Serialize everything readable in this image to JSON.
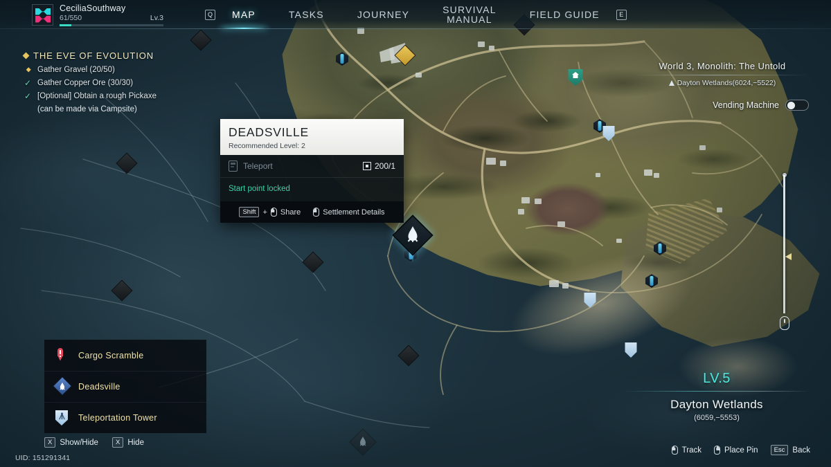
{
  "header": {
    "player_name": "CeciliaSouthway",
    "xp": "61/550",
    "level": "Lv.3",
    "xp_percent": 11,
    "nav_left_key": "Q",
    "nav_right_key": "E",
    "tabs": [
      {
        "label": "MAP",
        "active": true
      },
      {
        "label": "TASKS",
        "active": false
      },
      {
        "label": "JOURNEY",
        "active": false
      },
      {
        "label": "SURVIVAL",
        "label2": "MANUAL",
        "active": false
      },
      {
        "label": "FIELD GUIDE",
        "active": false
      }
    ]
  },
  "quest": {
    "title": "THE EVE OF EVOLUTION",
    "objectives": [
      {
        "text": "Gather Gravel  (20/50)",
        "state": "active"
      },
      {
        "text": "Gather Copper Ore  (30/30)",
        "state": "done"
      },
      {
        "text": "[Optional] Obtain a rough Pickaxe",
        "sub": "(can be made via Campsite)",
        "state": "done"
      }
    ]
  },
  "popup": {
    "name": "DEADSVILLE",
    "recommended_level": "Recommended Level: 2",
    "teleport_label": "Teleport",
    "teleport_cost": "200/1",
    "status": "Start point locked",
    "shift_key": "Shift",
    "plus": "+",
    "share_label": "Share",
    "details_label": "Settlement Details"
  },
  "world": {
    "title": "World 3, Monolith: The Untold",
    "coordinates": "Dayton Wetlands(6024,−5522)",
    "vending_label": "Vending Machine",
    "vending_on": false
  },
  "legend": {
    "items": [
      {
        "label": "Cargo Scramble",
        "icon": "cargo-pin-icon"
      },
      {
        "label": "Deadsville",
        "icon": "settlement-diamond-icon"
      },
      {
        "label": "Teleportation Tower",
        "icon": "teleport-tower-shield-icon"
      }
    ]
  },
  "location": {
    "level": "LV.5",
    "name": "Dayton Wetlands",
    "coordinates": "(6059,−5553)"
  },
  "bottom_left": {
    "items": [
      {
        "key": "X",
        "label": "Show/Hide"
      },
      {
        "key": "X",
        "label": "Hide"
      }
    ],
    "uid": "UID: 151291341"
  },
  "bottom_right": {
    "items": [
      {
        "key_type": "mouse",
        "label": "Track"
      },
      {
        "key_type": "mouse",
        "label": "Place Pin"
      },
      {
        "key_type": "kbd",
        "key": "Esc",
        "label": "Back"
      }
    ]
  },
  "colors": {
    "accent_cyan": "#4fe6dd",
    "quest_gold": "#f2e9c0",
    "status_green": "#3fd0a8",
    "legend_gold": "#f0e2a8",
    "marker_red": "#e04a5a"
  }
}
